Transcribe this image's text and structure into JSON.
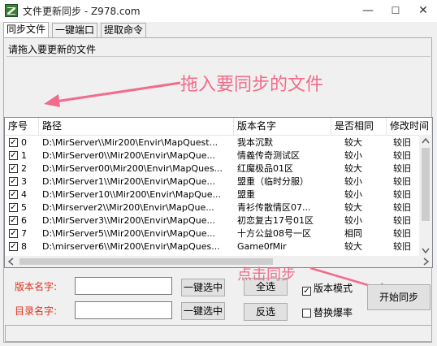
{
  "window": {
    "title": "文件更新同步 - Z978.com",
    "minimize": "—",
    "maximize": "☐",
    "close": "✕"
  },
  "tabs": [
    {
      "label": "同步文件",
      "active": true
    },
    {
      "label": "一键端口",
      "active": false
    },
    {
      "label": "提取命令",
      "active": false
    }
  ],
  "dropzone": {
    "label": "请拖入要更新的文件"
  },
  "annotations": {
    "drag_hint": "拖入要同步的文件",
    "click_hint": "点击同步",
    "color": "#f26b8a"
  },
  "table": {
    "headers": [
      "序号",
      "路径",
      "版本名字",
      "是否相同",
      "修改时间"
    ],
    "rows": [
      {
        "checked": true,
        "index": "0",
        "path": "D:\\MirServer\\\\Mir200\\Envir\\MapQuest...",
        "name": "我本沉默",
        "same": "较大",
        "time": "较旧"
      },
      {
        "checked": true,
        "index": "1",
        "path": "D:\\MirServer0\\\\Mir200\\Envir\\MapQue...",
        "name": "情義传奇测试区",
        "same": "较小",
        "time": "较旧"
      },
      {
        "checked": true,
        "index": "2",
        "path": "D:\\MirServer00\\Mir200\\Envir\\MapQues...",
        "name": "红魔极品01区",
        "same": "较大",
        "time": "较旧"
      },
      {
        "checked": true,
        "index": "3",
        "path": "D:\\MirServer1\\\\Mir200\\Envir\\MapQue...",
        "name": "盟重（临时分服）",
        "same": "较小",
        "time": "较旧"
      },
      {
        "checked": true,
        "index": "4",
        "path": "D:\\MirServer10\\\\Mir200\\Envir\\MapQue...",
        "name": "盟重",
        "same": "较小",
        "time": "较旧"
      },
      {
        "checked": true,
        "index": "5",
        "path": "D:\\Mirserver2\\\\Mir200\\Envir\\MapQue...",
        "name": "青衫传散情区07...",
        "same": "较大",
        "time": "较旧"
      },
      {
        "checked": true,
        "index": "6",
        "path": "D:\\MirServer3\\\\Mir200\\Envir\\MapQue...",
        "name": "初恋复古17号01区",
        "same": "较小",
        "time": "较旧"
      },
      {
        "checked": true,
        "index": "7",
        "path": "D:\\MirServer5\\\\Mir200\\Envir\\MapQue...",
        "name": "十方公益08号一区",
        "same": "相同",
        "time": "较旧"
      },
      {
        "checked": true,
        "index": "8",
        "path": "D:\\mirserver6\\\\Mir200\\Envir\\MapQues...",
        "name": "Game0fMir",
        "same": "较大",
        "time": "较旧"
      }
    ]
  },
  "form": {
    "version_label": "版本名字:",
    "dir_label": "目录名字:",
    "version_value": "",
    "dir_value": "",
    "select_version_button": "一键选中",
    "select_dir_button": "一键选中",
    "select_all_button": "全选",
    "invert_button": "反选",
    "version_mode_label": "版本模式",
    "version_mode_checked": true,
    "replace_label": "替换爆率",
    "replace_checked": false,
    "start_sync_button": "开始同步"
  },
  "status": {
    "text": ""
  }
}
